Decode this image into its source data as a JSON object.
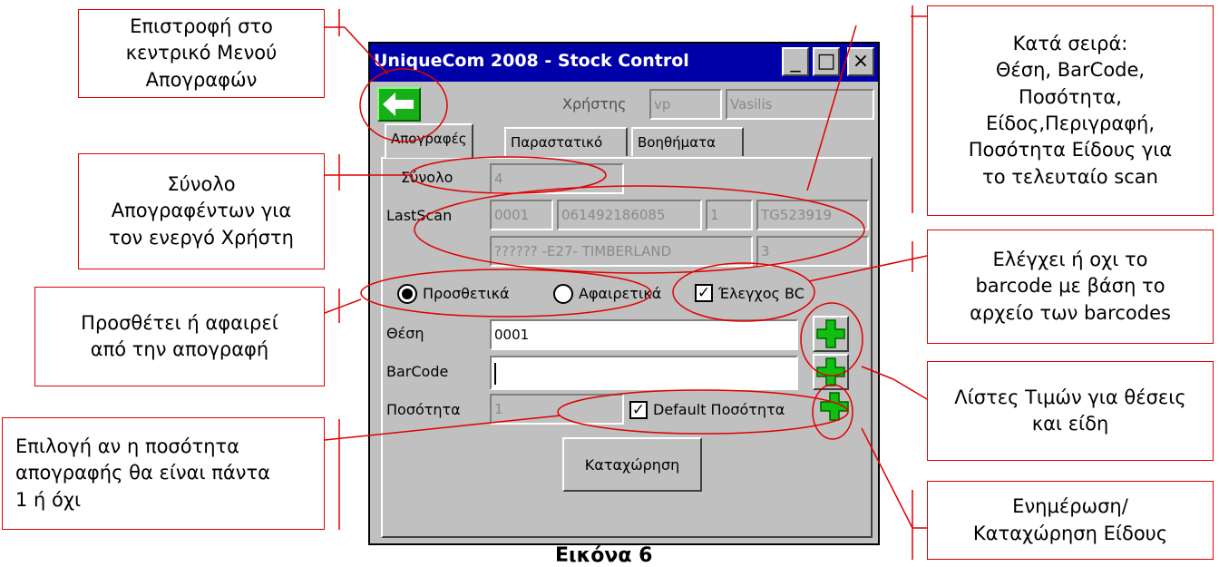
{
  "window": {
    "title": "UniqueCom 2008 - Stock Control",
    "minimize": "_",
    "maximize": "□",
    "close": "×",
    "back_icon": "arrow-left-icon",
    "user_label": "Χρήστης",
    "user_code": "vp",
    "user_name": "Vasilis",
    "tabs": [
      "Απογραφές",
      "Παραστατικό",
      "Βοηθήματα"
    ],
    "total_label": "Σύνολο",
    "total_value": "4",
    "lastscan_label": "LastScan",
    "lastscan": {
      "position": "0001",
      "barcode": "061492186085",
      "quantity": "1",
      "item": "TG523919",
      "description": "?????? -E27- TIMBERLAND",
      "item_quantity": "3"
    },
    "radio_add": "Προσθετικά",
    "radio_subtract": "Αφαιρετικά",
    "check_bc": "Έλεγχος BC",
    "position_label": "Θέση",
    "position_value": "0001",
    "barcode_label": "BarCode",
    "barcode_value": "",
    "quantity_label": "Ποσότητα",
    "quantity_value": "1",
    "default_qty": "Default Ποσότητα",
    "submit": "Καταχώρηση",
    "plus_icon": "green-plus-icon"
  },
  "callouts": {
    "back": "Επιστροφή στο\nκεντρικό Μενού\nΑπογραφών",
    "total": "Σύνολο\nΑπογραφέντων για\nτον ενεργό Χρήστη",
    "addsub": "Προσθέτει ή αφαιρεί\nαπό την απογραφή",
    "default_qty": "Επιλογή αν η ποσότητα\nαπογραφής θα είναι πάντα\n1 ή όχι",
    "lastscan": "Κατά σειρά:\nΘέση, BarCode,\nΠοσότητα,\nΕίδος,Περιγραφή,\nΠοσότητα Είδους για\nτο τελευταίο scan",
    "check_bc": "Ελέγχει ή οχι το\nbarcode με βάση το\nαρχείο των barcodes",
    "lists": "Λίστες Τιμών για θέσεις\nκαι είδη",
    "update": "Ενημέρωση/\nΚαταχώρηση Είδους"
  },
  "caption": "Εικόνα 6",
  "colors": {
    "annotation": "#e00000",
    "titlebar": "#0000a8",
    "plus": "#10c010"
  }
}
